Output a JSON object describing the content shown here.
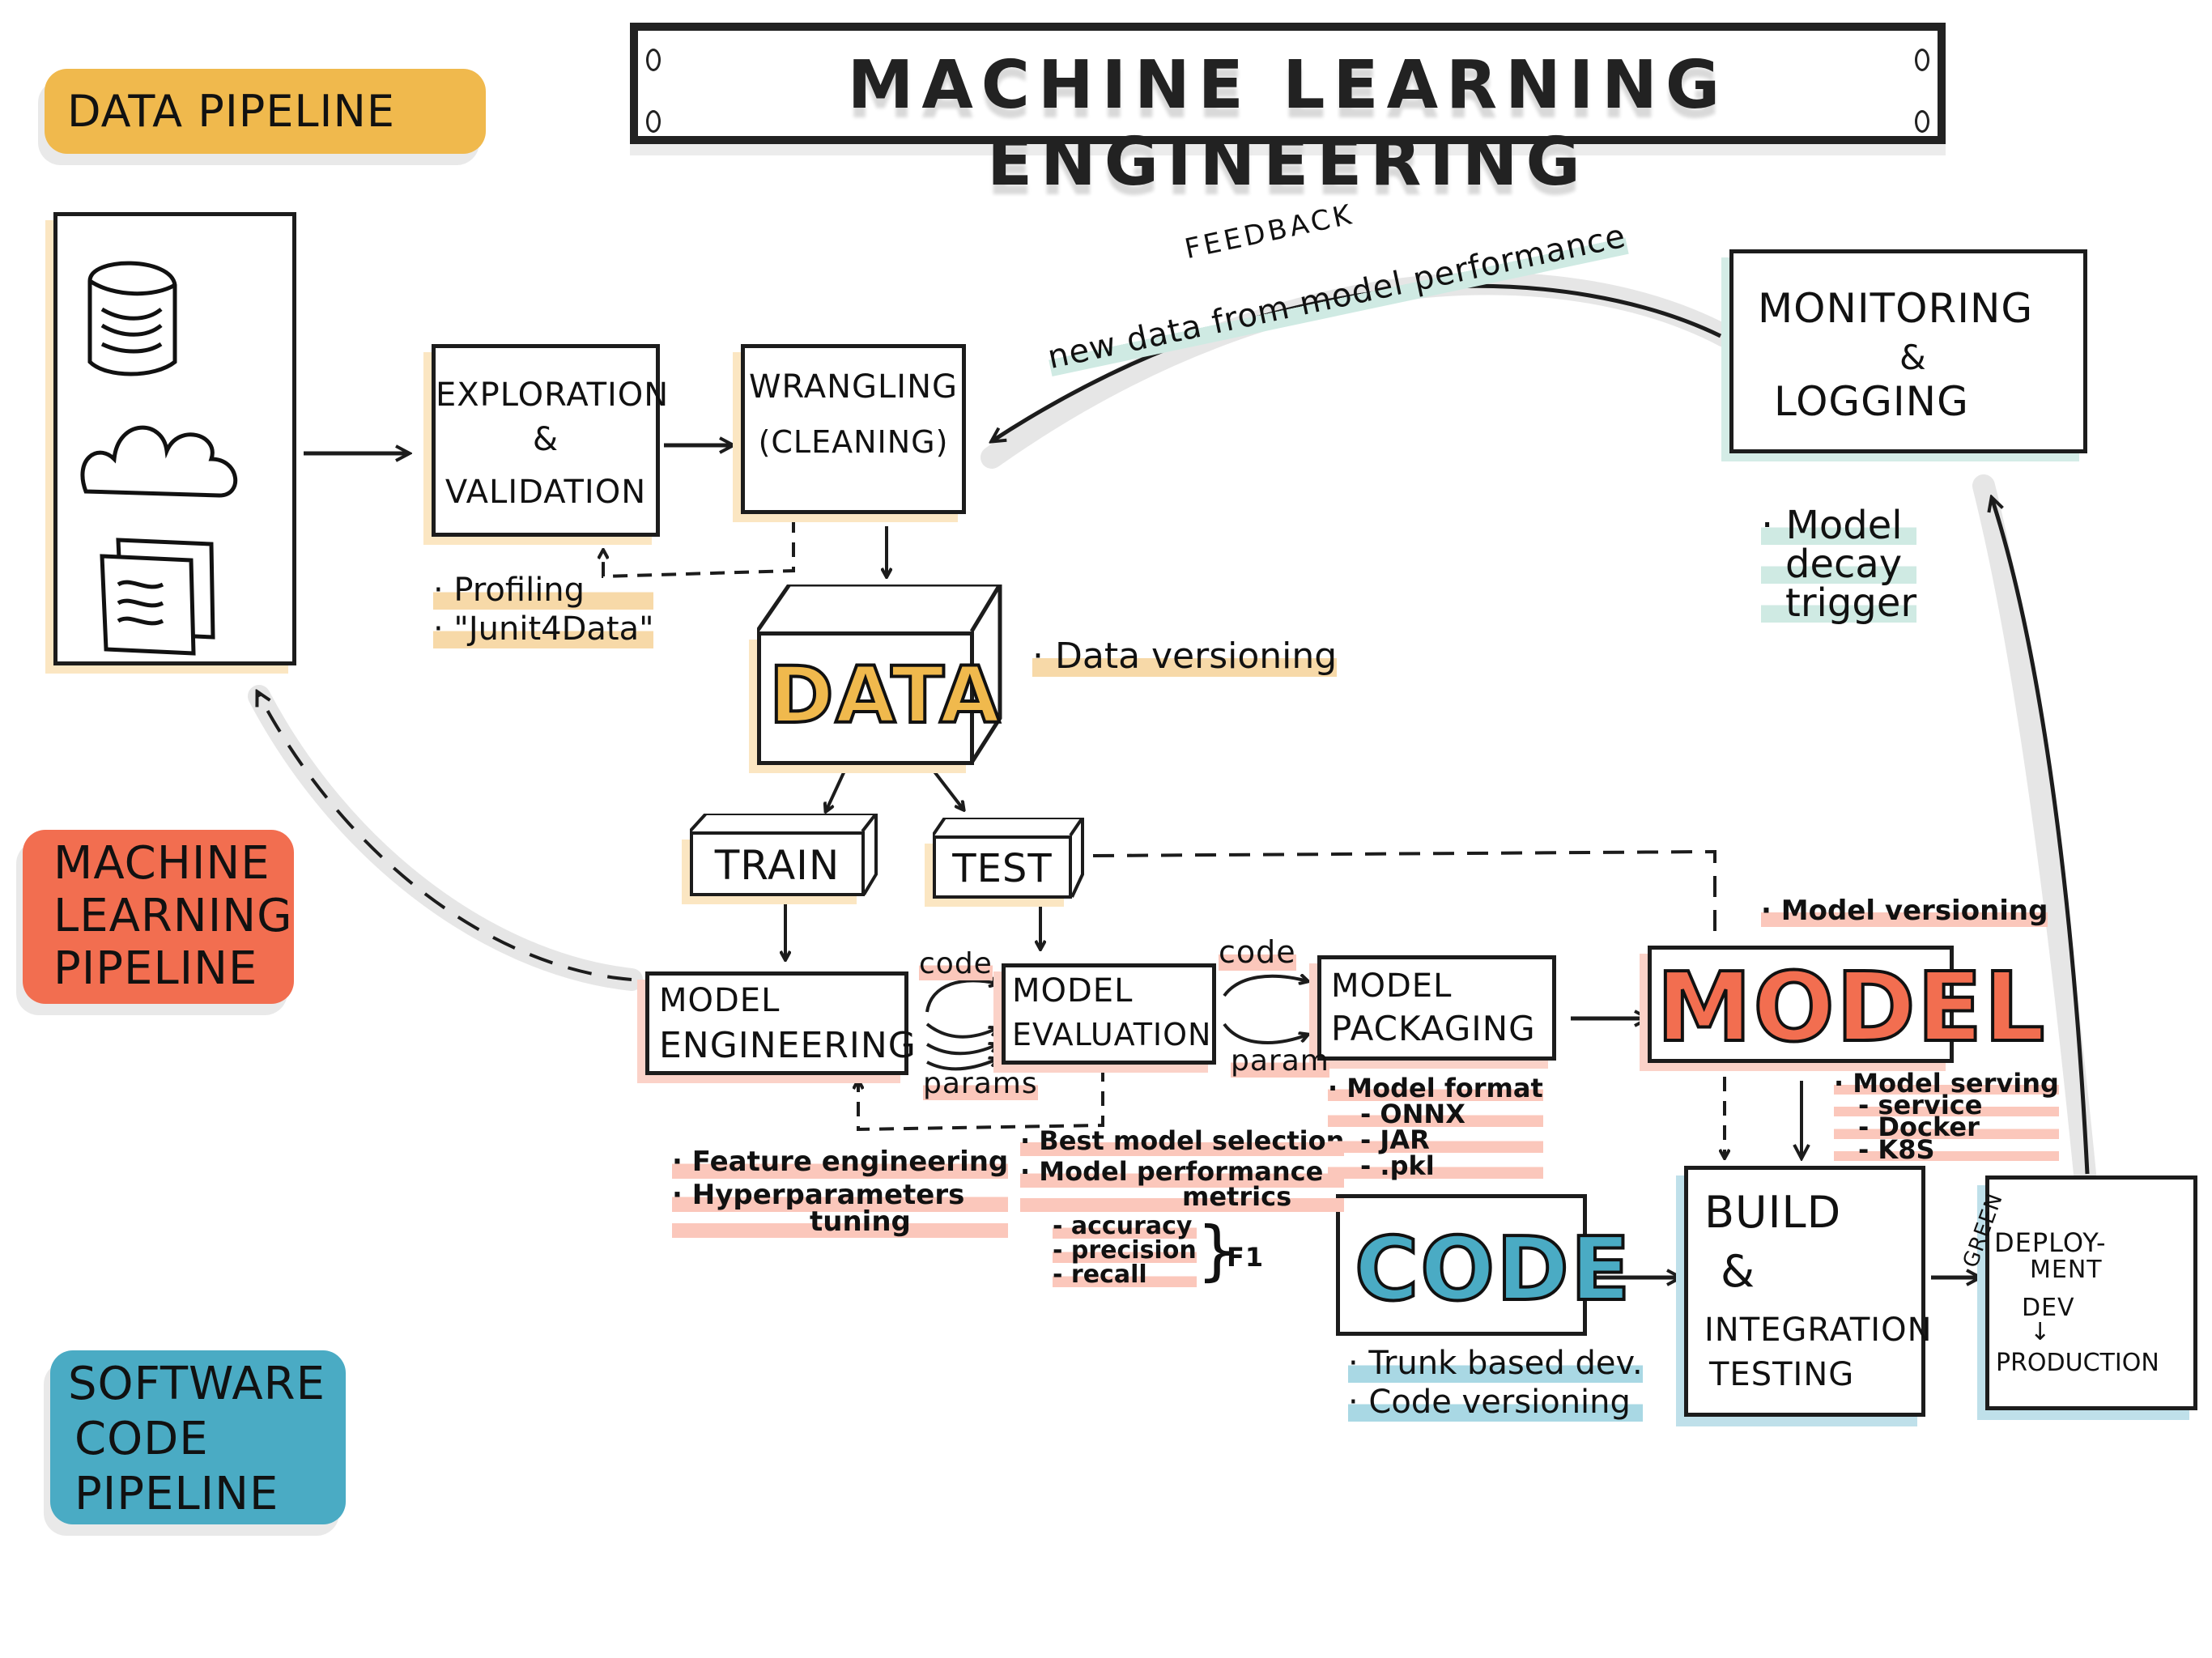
{
  "title": "MACHINE LEARNING ENGINEERING",
  "legend": {
    "data_pipeline": "DATA PIPELINE",
    "ml_pipeline": [
      "MACHINE",
      "LEARNING",
      "PIPELINE"
    ],
    "code_pipeline": [
      "SOFTWARE",
      "CODE",
      "PIPELINE"
    ]
  },
  "colors": {
    "data": "#f0b94d",
    "ml": "#f26e50",
    "code": "#4aabc4",
    "ops": "#b9e0d6",
    "ink": "#1c1c1c"
  },
  "data_sources": {
    "icons": [
      "database-icon",
      "cloud-icon",
      "documents-icon"
    ]
  },
  "nodes": {
    "exploration": [
      "EXPLORATION",
      "&",
      "VALIDATION"
    ],
    "wrangling": [
      "WRANGLING",
      "(CLEANING)"
    ],
    "data_cube": "DATA",
    "train": "TRAIN",
    "test": "TEST",
    "model_engineering": [
      "MODEL",
      "ENGINEERING"
    ],
    "model_evaluation": [
      "MODEL",
      "EVALUATION"
    ],
    "model_packaging": [
      "MODEL",
      "PACKAGING"
    ],
    "model_artifact": "MODEL",
    "code_artifact": "CODE",
    "build": [
      "BUILD",
      "&",
      "INTEGRATION",
      "TESTING"
    ],
    "deployment": [
      "DEPLOY-",
      "MENT",
      "DEV",
      "↓",
      "PRODUCTION"
    ],
    "monitoring": [
      "MONITORING",
      "&",
      "LOGGING"
    ]
  },
  "edge_labels": {
    "feedback": "FEEDBACK",
    "feedback_sub": "new data from model performance",
    "code_1": "code",
    "params_1": "params",
    "code_2": "code",
    "param_2": "param",
    "green": "GREEN"
  },
  "notes": {
    "exploration": [
      "Profiling",
      "\"Junit4Data\""
    ],
    "data": [
      "Data versioning"
    ],
    "monitoring": [
      "Model",
      "decay",
      "trigger"
    ],
    "model_engineering": [
      "Feature engineering",
      "Hyperparameters",
      "tuning"
    ],
    "model_evaluation": [
      "Best model selection",
      "Model performance",
      "metrics"
    ],
    "metrics": [
      "- accuracy",
      "- precision",
      "- recall"
    ],
    "metrics_group": "F1",
    "model_format": {
      "title": "Model format",
      "items": [
        "- ONNX",
        "- JAR",
        "- .pkl"
      ]
    },
    "model_versioning": [
      "Model versioning"
    ],
    "model_serving": {
      "title": "Model serving",
      "items": [
        "- service",
        "- Docker",
        "- K8S"
      ]
    },
    "code": [
      "Trunk based dev.",
      "Code versioning"
    ]
  }
}
